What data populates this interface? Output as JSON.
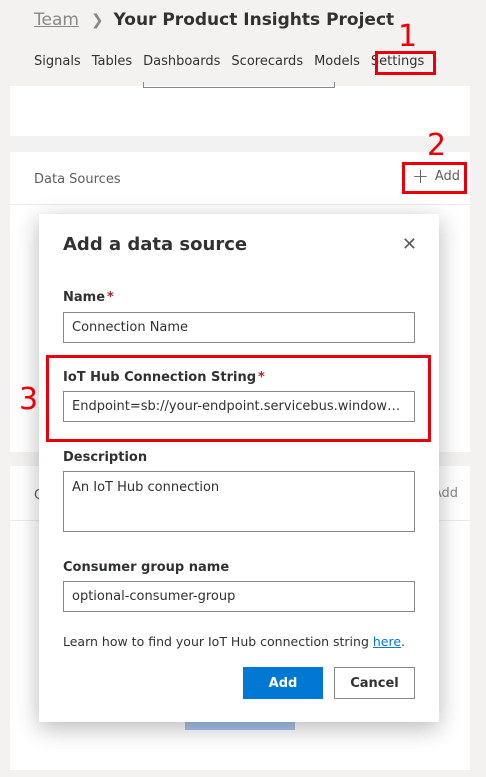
{
  "breadcrumb": {
    "team": "Team",
    "project": "Your Product Insights Project"
  },
  "nav": {
    "items": [
      "Signals",
      "Tables",
      "Dashboards",
      "Scorecards",
      "Models",
      "Settings"
    ]
  },
  "data_sources": {
    "title": "Data Sources",
    "add_label": "Add"
  },
  "second_card": {
    "add_label": "Add"
  },
  "annotations": {
    "step1": "1",
    "step2": "2",
    "step3": "3",
    "color": "#e8000b"
  },
  "dialog": {
    "title": "Add a data source",
    "name": {
      "label": "Name",
      "value": "Connection Name"
    },
    "connection_string": {
      "label": "IoT Hub Connection String",
      "value": "Endpoint=sb://your-endpoint.servicebus.windows.n..."
    },
    "description": {
      "label": "Description",
      "value": "An IoT Hub connection"
    },
    "consumer_group": {
      "label": "Consumer group name",
      "value": "optional-consumer-group"
    },
    "help_text": "Learn how to find your IoT Hub connection string ",
    "help_link": "here",
    "help_suffix": ".",
    "required_mark": "*",
    "add_button": "Add",
    "cancel_button": "Cancel",
    "accent_color": "#0078d4"
  },
  "icons": {
    "plus": "plus-icon",
    "close": "close-icon",
    "chevron": "chevron-right-icon"
  }
}
